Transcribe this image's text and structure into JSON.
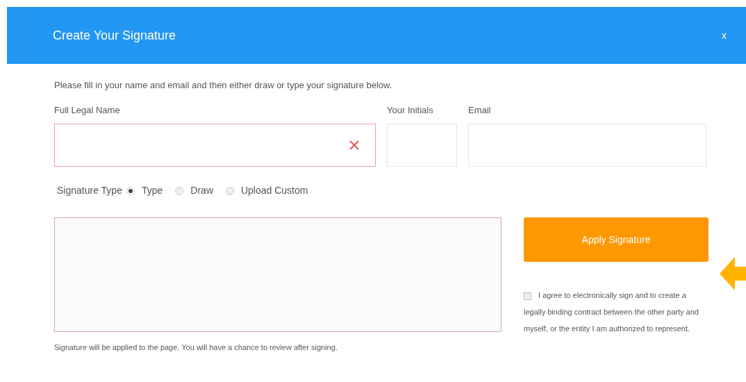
{
  "dialog": {
    "title": "Create Your Signature",
    "close": "x"
  },
  "instructions": "Please fill in your name and email and then either draw or type your signature below.",
  "fields": [
    {
      "label": "Full Legal Name",
      "invalid": true
    },
    {
      "label": "Your Initials",
      "invalid": false
    },
    {
      "label": "Email",
      "invalid": false
    }
  ],
  "signature_type": {
    "label": "Signature Type",
    "options": [
      {
        "label": "Type",
        "selected": true
      },
      {
        "label": "Draw",
        "selected": false
      },
      {
        "label": "Upload Custom",
        "selected": false
      }
    ]
  },
  "apply_button": "Apply Signature",
  "agreement": {
    "text": "I agree to electronically sign and to create a legally binding contract between the other party and myself, or the entity I am authorized to represent.",
    "checked": false
  },
  "footer_note": "Signature will be applied to the page. You will have a chance to review after signing."
}
